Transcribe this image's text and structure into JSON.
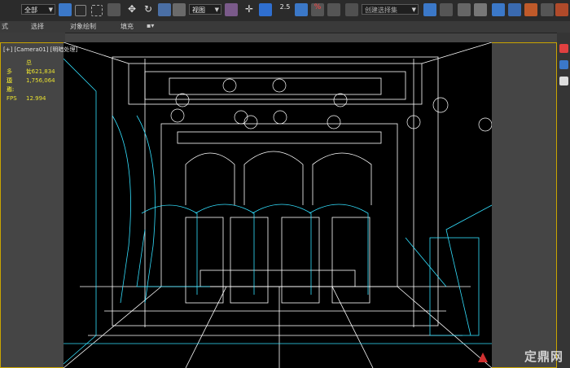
{
  "toolbar": {
    "selection_filter": "全部",
    "reference_coord": "视图",
    "snap_value": "2.5",
    "named_selection_placeholder": "创建选择集"
  },
  "ribbon": {
    "tabs": [
      "式",
      "选择",
      "对象绘制",
      "填充"
    ]
  },
  "viewport": {
    "label": "[+] [Camera01] [明暗处理]",
    "stats": {
      "title": "总计",
      "polys_label": "多边形:",
      "polys_value": "1,621,834",
      "verts_label": "顶点:",
      "verts_value": "1,756,064",
      "fps_label": "FPS",
      "fps_value": "12.994"
    }
  },
  "watermark": {
    "text": "定鼎网"
  },
  "colors": {
    "wire_white": "#ffffff",
    "wire_cyan": "#33e0ff",
    "stats_yellow": "#e8e030",
    "frame_border": "#c9a400"
  }
}
